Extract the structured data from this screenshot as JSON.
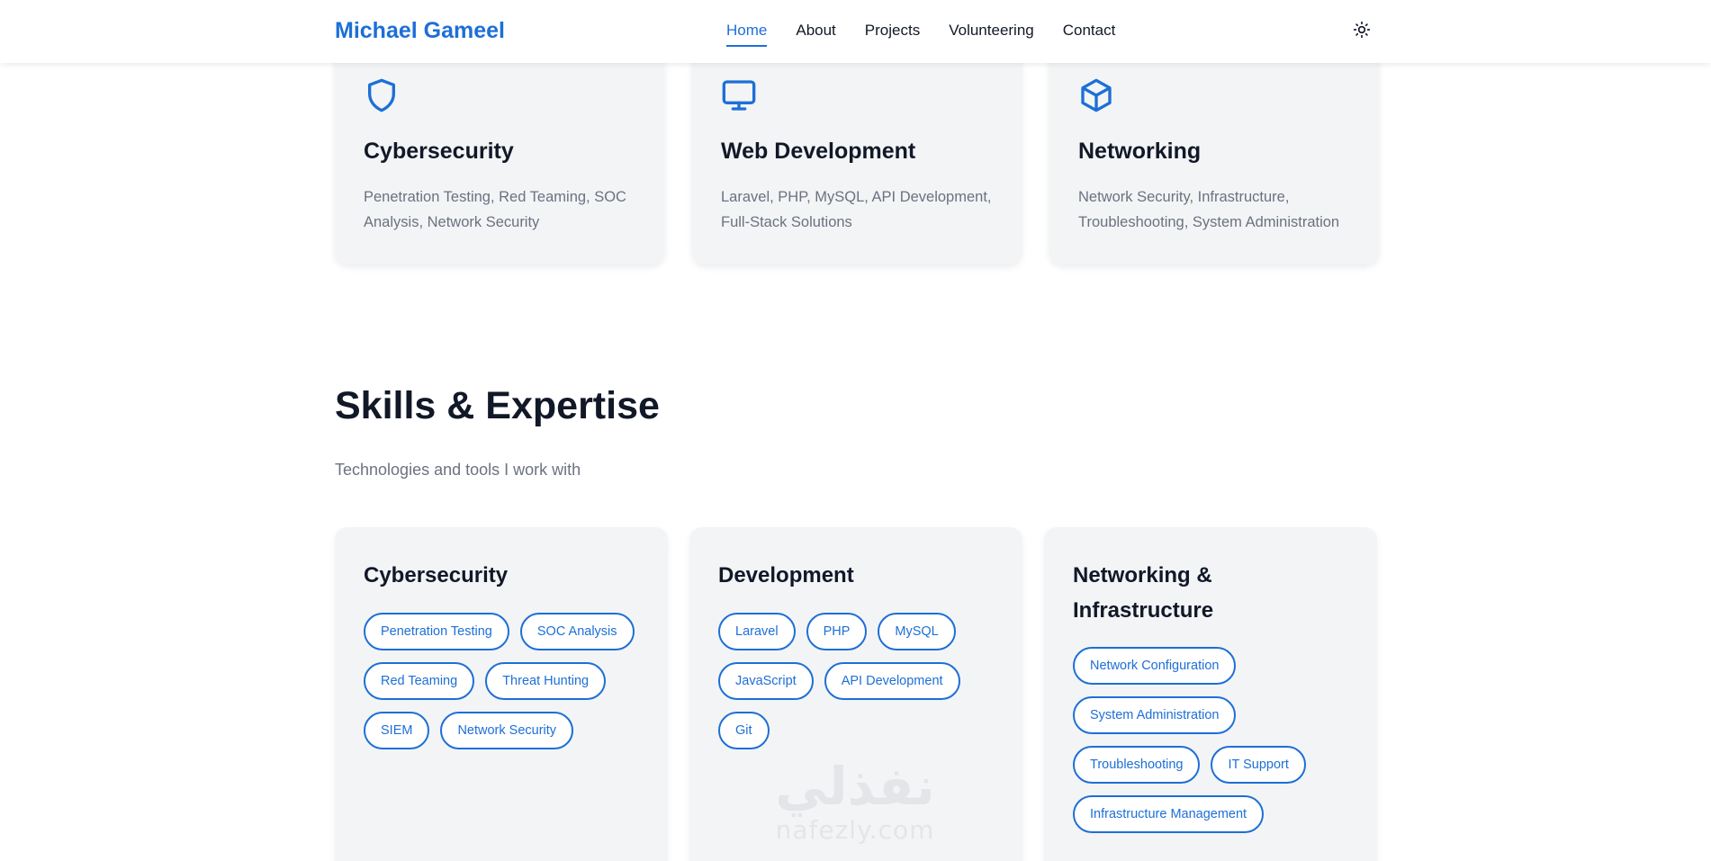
{
  "header": {
    "brand": "Michael Gameel",
    "nav": [
      {
        "label": "Home",
        "active": true
      },
      {
        "label": "About",
        "active": false
      },
      {
        "label": "Projects",
        "active": false
      },
      {
        "label": "Volunteering",
        "active": false
      },
      {
        "label": "Contact",
        "active": false
      }
    ],
    "theme_toggle_icon": "sun-icon"
  },
  "services": [
    {
      "icon": "shield-icon",
      "title": "Cybersecurity",
      "description": "Penetration Testing, Red Teaming, SOC Analysis, Network Security"
    },
    {
      "icon": "monitor-icon",
      "title": "Web Development",
      "description": "Laravel, PHP, MySQL, API Development, Full-Stack Solutions"
    },
    {
      "icon": "cube-icon",
      "title": "Networking",
      "description": "Network Security, Infrastructure, Troubleshooting, System Administration"
    }
  ],
  "skills": {
    "title": "Skills & Expertise",
    "subtitle": "Technologies and tools I work with",
    "categories": [
      {
        "title": "Cybersecurity",
        "tags": [
          "Penetration Testing",
          "SOC Analysis",
          "Red Teaming",
          "Threat Hunting",
          "SIEM",
          "Network Security"
        ]
      },
      {
        "title": "Development",
        "tags": [
          "Laravel",
          "PHP",
          "MySQL",
          "JavaScript",
          "API Development",
          "Git"
        ]
      },
      {
        "title": "Networking & Infrastructure",
        "tags": [
          "Network Configuration",
          "System Administration",
          "Troubleshooting",
          "IT Support",
          "Infrastructure Management"
        ]
      }
    ]
  },
  "watermark": {
    "text": "nafezly.com",
    "arabic": "نفذلي"
  },
  "colors": {
    "accent": "#1d6fd6",
    "text": "#111827",
    "muted": "#6b7280",
    "card_bg": "#f3f4f6"
  }
}
